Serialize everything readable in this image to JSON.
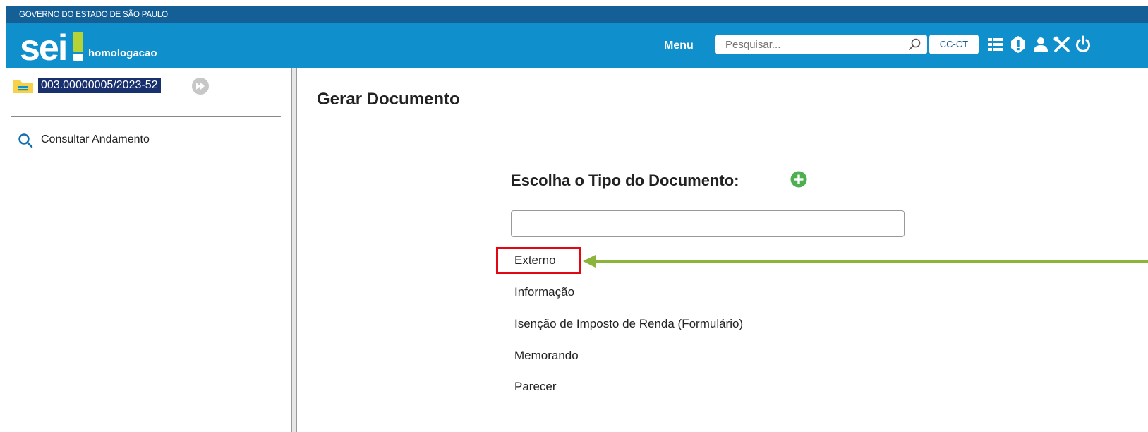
{
  "gov_bar": {
    "text": "GOVERNO DO ESTADO DE SÃO PAULO"
  },
  "header": {
    "logo_text": "sei!",
    "environment": "homologacao",
    "menu_label": "Menu",
    "search_placeholder": "Pesquisar...",
    "unit": "CC-CT",
    "icons": [
      "list-icon",
      "alert-icon",
      "user-icon",
      "tools-icon",
      "power-icon"
    ]
  },
  "sidebar": {
    "process_number": "003.00000005/2023-52",
    "consultar_label": "Consultar Andamento"
  },
  "main": {
    "title": "Gerar Documento",
    "choose_label": "Escolha o Tipo do Documento:",
    "filter_value": "",
    "document_types": [
      "Externo",
      "Informação",
      "Isenção de Imposto de Renda (Formulário)",
      "Memorando",
      "Parecer"
    ]
  },
  "annotation": {
    "highlight_color": "#e30613",
    "arrow_color": "#8cb33a",
    "highlighted_item": "Externo"
  },
  "colors": {
    "gov_bar": "#155f97",
    "app_bar": "#0f8fcc",
    "process_badge": "#19306f",
    "add_button": "#4caf50"
  }
}
